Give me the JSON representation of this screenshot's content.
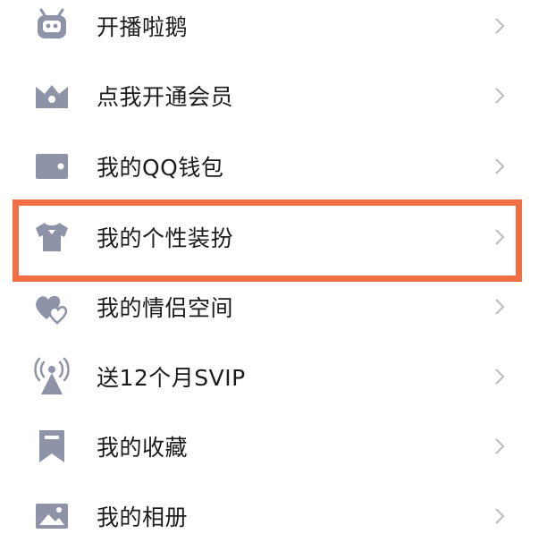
{
  "accent_color": "#f07044",
  "icon_color": "#8f93a8",
  "menu": {
    "items": [
      {
        "label": "开播啦鹅",
        "icon": "robot-face-icon"
      },
      {
        "label": "点我开通会员",
        "icon": "crown-icon"
      },
      {
        "label": "我的QQ钱包",
        "icon": "wallet-icon"
      },
      {
        "label": "我的个性装扮",
        "icon": "tshirt-icon",
        "highlighted": true
      },
      {
        "label": "我的情侣空间",
        "icon": "double-heart-icon"
      },
      {
        "label": "送12个月SVIP",
        "icon": "broadcast-tower-icon"
      },
      {
        "label": "我的收藏",
        "icon": "bookmark-icon"
      },
      {
        "label": "我的相册",
        "icon": "photo-album-icon"
      }
    ]
  }
}
